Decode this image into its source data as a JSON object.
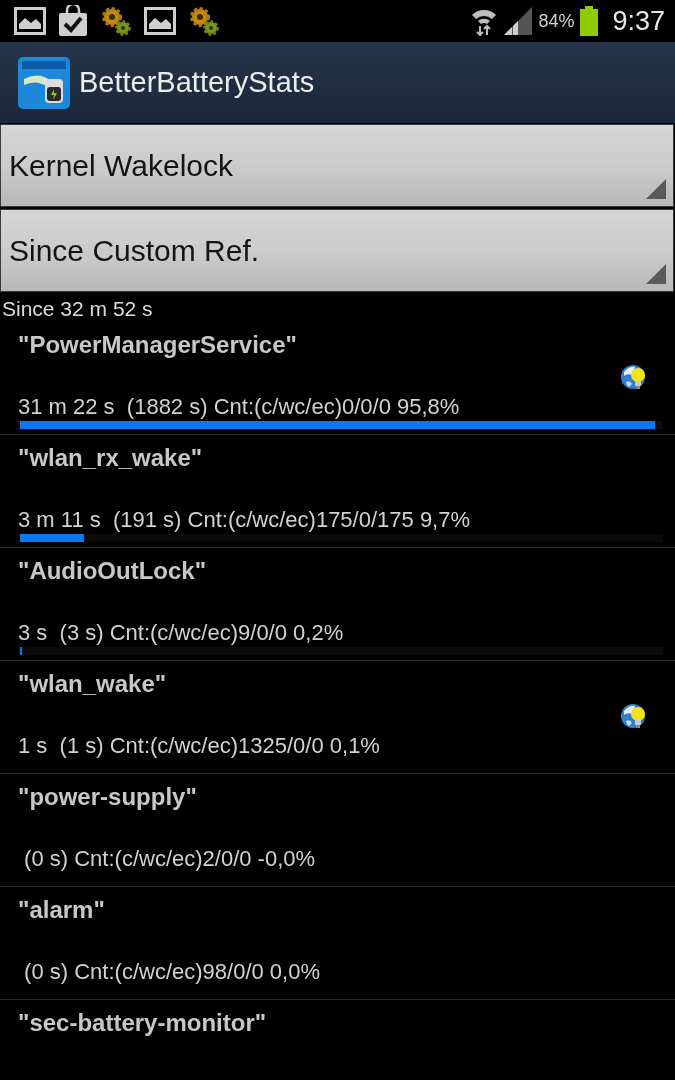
{
  "status_bar": {
    "notifications": [
      {
        "kind": "image"
      },
      {
        "kind": "bag"
      },
      {
        "kind": "gears"
      },
      {
        "kind": "image"
      },
      {
        "kind": "gears"
      }
    ],
    "battery": "84%",
    "time": "9:37"
  },
  "app_bar": {
    "title": "BetterBatteryStats"
  },
  "dropdowns": [
    {
      "value": "Kernel Wakelock"
    },
    {
      "value": "Since Custom Ref."
    }
  ],
  "since": "Since 32 m 52 s",
  "rows": [
    {
      "name": "\"PowerManagerService\"",
      "stats": "31 m 22 s  (1882 s) Cnt:(c/wc/ec)0/0/0 95,8%",
      "level": 0.988,
      "icon": true
    },
    {
      "name": "\"wlan_rx_wake\"",
      "stats": "3 m 11 s  (191 s) Cnt:(c/wc/ec)175/0/175 9,7%",
      "level": 0.1,
      "icon": false
    },
    {
      "name": "\"AudioOutLock\"",
      "stats": "3 s  (3 s) Cnt:(c/wc/ec)9/0/0 0,2%",
      "level": 0.003,
      "icon": false
    },
    {
      "name": "\"wlan_wake\"",
      "stats": "1 s  (1 s) Cnt:(c/wc/ec)1325/0/0 0,1%",
      "icon": true
    },
    {
      "name": "\"power-supply\"",
      "stats": " (0 s) Cnt:(c/wc/ec)2/0/0 -0,0%",
      "icon": false
    },
    {
      "name": "\"alarm\"",
      "stats": " (0 s) Cnt:(c/wc/ec)98/0/0 0,0%",
      "icon": false
    },
    {
      "name": "\"sec-battery-monitor\"",
      "icon": false
    }
  ]
}
